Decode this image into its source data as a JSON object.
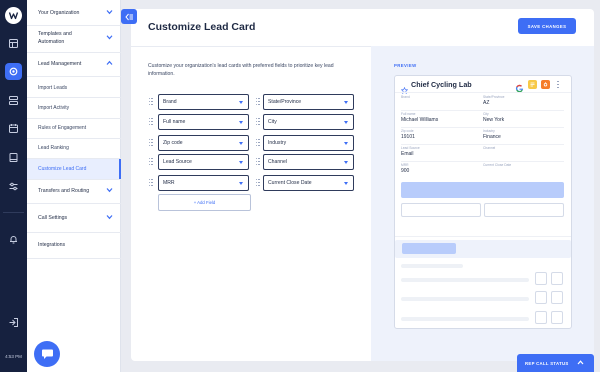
{
  "rail": {
    "time": "4:53 PM"
  },
  "sidebar": {
    "groups": [
      {
        "label": "Your Organization"
      },
      {
        "label": "Templates and Automation"
      },
      {
        "label": "Lead Management"
      },
      {
        "label": "Transfers and Routing"
      },
      {
        "label": "Call Settings"
      },
      {
        "label": "Integrations"
      }
    ],
    "lead_items": [
      {
        "label": "Import Leads"
      },
      {
        "label": "Import Activity"
      },
      {
        "label": "Rules of Engagement"
      },
      {
        "label": "Lead Ranking"
      },
      {
        "label": "Customize Lead Card"
      }
    ]
  },
  "header": {
    "title": "Customize Lead Card",
    "save_label": "SAVE CHANGES"
  },
  "main": {
    "description": "Customize your organization's lead cards with preferred fields to prioritize key lead information.",
    "left_fields": [
      "Brand",
      "Full name",
      "Zip code",
      "Lead Source",
      "MRR"
    ],
    "right_fields": [
      "State/Province",
      "City",
      "Industry",
      "Channel",
      "Current Close Date"
    ],
    "add_field_label": "+ Add Field"
  },
  "preview": {
    "label": "PREVIEW",
    "card_name": "Chief Cycling Lab",
    "fields": [
      {
        "label": "Brand",
        "value": ""
      },
      {
        "label": "State/Province",
        "value": "AZ"
      },
      {
        "label": "Full name",
        "value": "Michael Williams"
      },
      {
        "label": "City",
        "value": "New York"
      },
      {
        "label": "Zip code",
        "value": "19101"
      },
      {
        "label": "Industry",
        "value": "Finance"
      },
      {
        "label": "Lead Source",
        "value": "Email"
      },
      {
        "label": "Channel",
        "value": ""
      },
      {
        "label": "MRR",
        "value": "900"
      },
      {
        "label": "Current Close Date",
        "value": ""
      }
    ]
  },
  "footer": {
    "rep_status": "REP CALL STATUS"
  },
  "colors": {
    "accent": "#3e6ef5",
    "rail_bg": "#16213f",
    "text": "#1f2a44"
  },
  "icons": {
    "rail": [
      "logo-icon",
      "inbox-icon",
      "settings-icon",
      "queue-icon",
      "calendar-icon",
      "book-icon",
      "routing-icon",
      "bell-icon",
      "logout-icon"
    ],
    "card": [
      "star-icon",
      "google-icon",
      "note-icon",
      "hubspot-icon",
      "more-icon"
    ]
  }
}
